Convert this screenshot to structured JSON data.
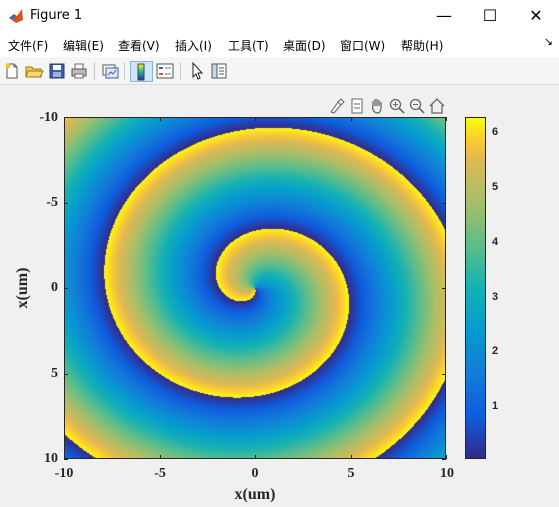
{
  "window": {
    "title": "Figure 1",
    "minimize": "—",
    "maximize": "☐",
    "close": "✕"
  },
  "menu": {
    "items": [
      "文件(F)",
      "编辑(E)",
      "查看(V)",
      "插入(I)",
      "工具(T)",
      "桌面(D)",
      "窗口(W)",
      "帮助(H)"
    ],
    "dock_arrow": "↘"
  },
  "toolbar": {
    "buttons": [
      "new-figure-icon",
      "open-file-icon",
      "save-icon",
      "print-icon",
      "link-plot-icon",
      "colorbar-icon",
      "legend-icon",
      "pointer-icon",
      "property-inspector-icon"
    ]
  },
  "axes_toolbar": {
    "buttons": [
      "brush-icon",
      "data-tips-icon",
      "pan-icon",
      "zoom-in-icon",
      "zoom-out-icon",
      "home-icon"
    ]
  },
  "chart_data": {
    "type": "heatmap",
    "xlabel": "x(um)",
    "ylabel": "x(um)",
    "xlim": [
      -10,
      10
    ],
    "ylim": [
      -10,
      10
    ],
    "y_direction": "reversed",
    "xticks": [
      "-10",
      "-5",
      "0",
      "5",
      "10"
    ],
    "yticks": [
      "-10",
      "-5",
      "0",
      "5",
      "10"
    ],
    "colormap": "parula",
    "clim": [
      0,
      6.283
    ],
    "colorbar_ticks": [
      "1",
      "2",
      "3",
      "4",
      "5",
      "6"
    ],
    "phase_formula": "mod(theta + r*1.05, 2*pi)",
    "description_colors": {
      "low": "#352a87",
      "mid": "#21b1b3",
      "high": "#f9fb0e"
    }
  }
}
